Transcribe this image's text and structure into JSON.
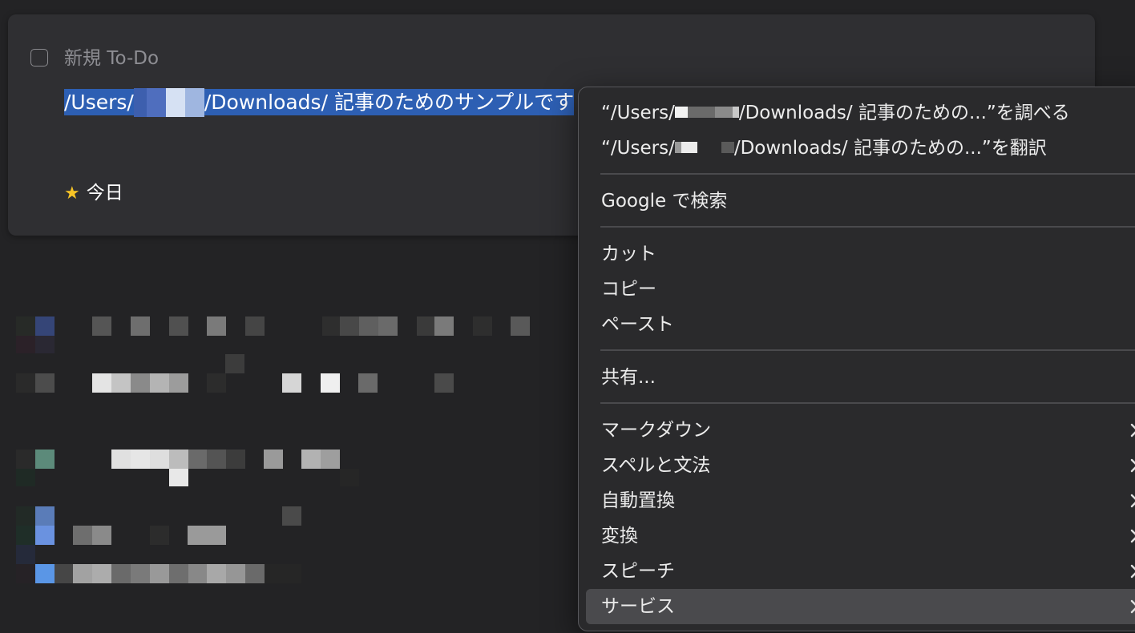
{
  "todo": {
    "title": "新規 To-Do",
    "notes_prefix": "/Users/",
    "notes_suffix": "/Downloads/ 記事のためのサンプルです",
    "when_label": "今日",
    "when_icon": "star-icon"
  },
  "context_menu": {
    "lookup_label_prefix": "“/Users/",
    "lookup_label_suffix": "/Downloads/ 記事のための...”を調べる",
    "translate_label_prefix": "“/Users/",
    "translate_label_suffix": "/Downloads/ 記事のための...”を翻訳",
    "search_google": "Google で検索",
    "cut": "カット",
    "copy": "コピー",
    "paste": "ペースト",
    "share": "共有...",
    "markdown": "マークダウン",
    "spelling": "スペルと文法",
    "substitutions": "自動置換",
    "transformations": "変換",
    "speech": "スピーチ",
    "services": "サービス"
  },
  "colors": {
    "background": "#232325",
    "card": "#2f2f32",
    "selection": "#2d5fb3",
    "menu": "#2a2a2c",
    "menu_highlight": "#4a4a4d",
    "star": "#f7c426"
  }
}
